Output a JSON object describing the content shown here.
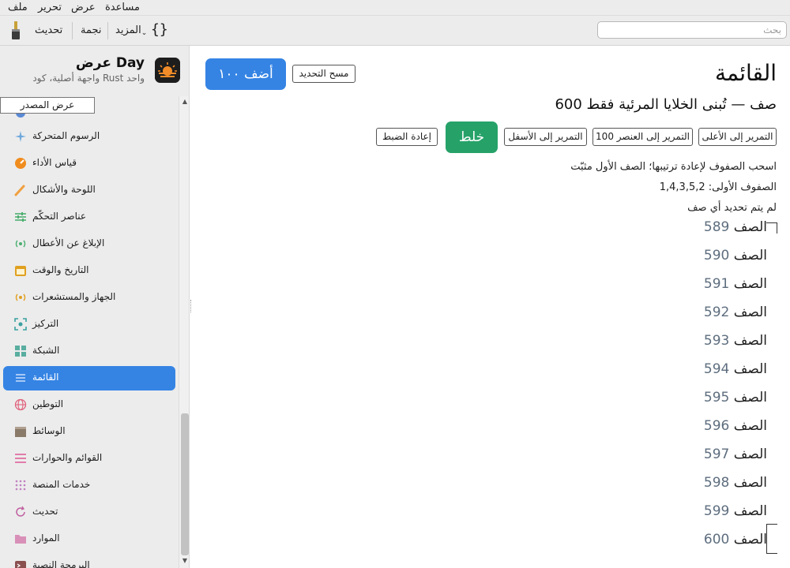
{
  "menu": [
    "ملف",
    "تحرير",
    "عرض",
    "مساعدة"
  ],
  "toolbar": {
    "update": "تحديث",
    "star": "نجمة",
    "more": "المزيد",
    "braces": "{}",
    "search_placeholder": "بحث"
  },
  "app": {
    "title": "عرض Day",
    "subtitle": "واجهة أصلية، كود Rust واحد",
    "source_button": "عرض المصدر"
  },
  "sidebar": {
    "items": [
      {
        "label": "الرسوم المتحركة",
        "icon": "sparkle-icon"
      },
      {
        "label": "قياس الأداء",
        "icon": "gauge-icon"
      },
      {
        "label": "اللوحة والأشكال",
        "icon": "brush-icon"
      },
      {
        "label": "عناصر التحكّم",
        "icon": "sliders-icon"
      },
      {
        "label": "الإبلاغ عن الأعطال",
        "icon": "broadcast-icon"
      },
      {
        "label": "التاريخ والوقت",
        "icon": "calendar-icon"
      },
      {
        "label": "الجهاز والمستشعرات",
        "icon": "sensor-icon"
      },
      {
        "label": "التركيز",
        "icon": "focus-icon"
      },
      {
        "label": "الشبكة",
        "icon": "grid-icon"
      },
      {
        "label": "القائمة",
        "icon": "list-icon"
      },
      {
        "label": "التوطين",
        "icon": "globe-icon"
      },
      {
        "label": "الوسائط",
        "icon": "clapper-icon"
      },
      {
        "label": "القوائم والحوارات",
        "icon": "menu-lines-icon"
      },
      {
        "label": "خدمات المنصة",
        "icon": "dots-grid-icon"
      },
      {
        "label": "تحديث",
        "icon": "refresh-icon"
      },
      {
        "label": "الموارد",
        "icon": "folder-icon"
      },
      {
        "label": "البرمجة النصية",
        "icon": "terminal-icon"
      }
    ],
    "active": "القائمة"
  },
  "main": {
    "title": "القائمة",
    "add_button": "أضف ١٠٠",
    "clear_button": "مسح التحديد",
    "subtitle": "600 صف — تُبنى الخلايا المرئية فقط",
    "buttons": {
      "scroll_top": "التمرير إلى الأعلى",
      "scroll_100": "التمرير إلى العنصر 100",
      "scroll_bottom": "التمرير إلى الأسفل",
      "shuffle": "خلط",
      "reset": "إعادة الضبط"
    },
    "hint": "اسحب الصفوف لإعادة ترتيبها؛ الصف الأول مثبّت",
    "first_rows": "الصفوف الأولى: 1,4,3,5,2",
    "selection": "لم يتم تحديد أي صف",
    "row_prefix": "الصف",
    "rows": [
      "589",
      "590",
      "591",
      "592",
      "593",
      "594",
      "595",
      "596",
      "597",
      "598",
      "599",
      "600"
    ]
  },
  "colors": {
    "accent": "#3584e4",
    "shuffle": "#26a269",
    "row_number": "#5d6d7e"
  }
}
